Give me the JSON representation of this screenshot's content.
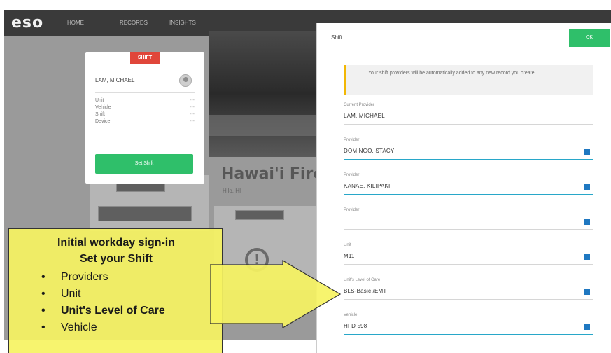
{
  "app": {
    "logo": "eso",
    "nav": [
      "HOME",
      "RECORDS",
      "INSIGHTS"
    ]
  },
  "background": {
    "station_title": "Hawai'i Fire",
    "station_sub": "Hilo, HI"
  },
  "shift_card": {
    "badge": "SHIFT",
    "name": "LAM, MICHAEL",
    "rows": [
      {
        "label": "Unit",
        "value": "---"
      },
      {
        "label": "Vehicle",
        "value": "---"
      },
      {
        "label": "Shift",
        "value": "---"
      },
      {
        "label": "Device",
        "value": "---"
      }
    ],
    "button": "Set Shift"
  },
  "modal": {
    "title": "Shift",
    "ok": "OK",
    "notice": "Your shift providers will be automatically added to any new record you create.",
    "fields": [
      {
        "label": "Current Provider",
        "value": "LAM, MICHAEL",
        "has_menu": false
      },
      {
        "label": "Provider",
        "value": "DOMINGO, STACY",
        "has_menu": true
      },
      {
        "label": "Provider",
        "value": "KANAE, KILIPAKI",
        "has_menu": true
      },
      {
        "label": "Provider",
        "value": "",
        "has_menu": true
      },
      {
        "label": "Unit",
        "value": "M11",
        "has_menu": true
      },
      {
        "label": "Unit's Level of Care",
        "value": "BLS-Basic /EMT",
        "has_menu": true
      },
      {
        "label": "Vehicle",
        "value": "HFD 598",
        "has_menu": true
      }
    ]
  },
  "callout": {
    "title": "Initial workday sign-in",
    "subtitle": "Set your Shift",
    "items": [
      {
        "text": "Providers",
        "bold": false
      },
      {
        "text": "Unit",
        "bold": false
      },
      {
        "text": "Unit's Level of Care",
        "bold": true
      },
      {
        "text": "Vehicle",
        "bold": false
      }
    ]
  },
  "colors": {
    "accent_green": "#2fbf6a",
    "badge_red": "#e0463a",
    "notice_yellow": "#f2b705",
    "callout_yellow": "#f6f362",
    "focus_blue": "#28a7c9"
  }
}
